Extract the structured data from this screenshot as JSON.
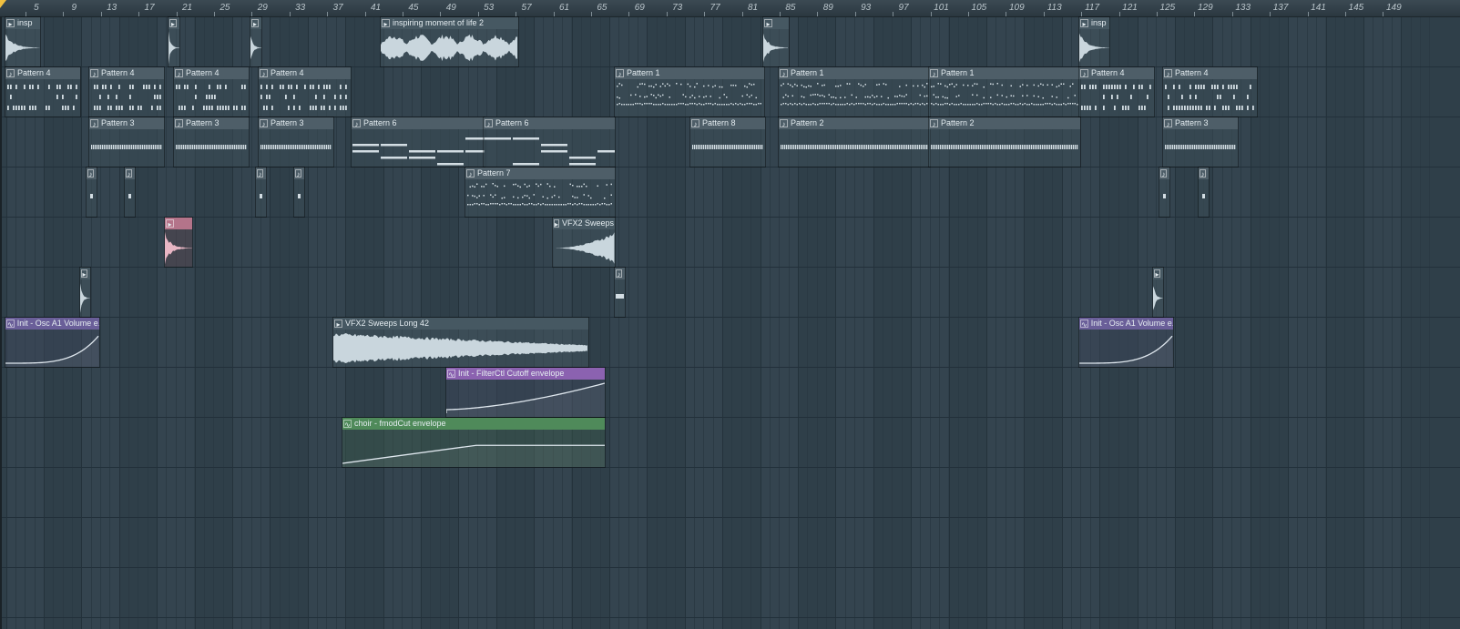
{
  "ruler": {
    "ticks": [
      "5",
      "9",
      "13",
      "17",
      "21",
      "25",
      "29",
      "33",
      "37",
      "41",
      "45",
      "49",
      "53",
      "57",
      "61",
      "65",
      "69",
      "73",
      "77",
      "81",
      "85",
      "89",
      "93",
      "97",
      "101",
      "105",
      "109",
      "113",
      "117",
      "121",
      "125",
      "129",
      "133",
      "137",
      "141",
      "145",
      "149"
    ]
  },
  "colors": {
    "background": "#2f3f49",
    "pattern_header": "#4e5e68",
    "audio_waveform": "#c9d6dd",
    "automation_purple": "#6a5f99",
    "automation_violet": "#8b62b0",
    "automation_green": "#4f8a5a",
    "audio_pink": "#b4748a"
  },
  "clips": [
    {
      "kind": "audio",
      "style": "audio",
      "label": "insp",
      "icon": "audio-clip-icon"
    },
    {
      "kind": "audio",
      "style": "audio",
      "label": "",
      "icon": "audio-clip-icon"
    },
    {
      "kind": "audio",
      "style": "audio",
      "label": "",
      "icon": "audio-clip-icon"
    },
    {
      "kind": "audio",
      "style": "audio",
      "label": "inspiring moment of life 2",
      "icon": "audio-clip-icon"
    },
    {
      "kind": "audio",
      "style": "audio",
      "label": "",
      "icon": "audio-clip-icon"
    },
    {
      "kind": "audio",
      "style": "audio",
      "label": "insp",
      "icon": "audio-clip-icon"
    },
    {
      "kind": "pattern",
      "style": "pattern",
      "label": "Pattern 4",
      "icon": "pattern-clip-icon",
      "notes": "drums"
    },
    {
      "kind": "pattern",
      "style": "pattern",
      "label": "Pattern 4",
      "icon": "pattern-clip-icon",
      "notes": "drums"
    },
    {
      "kind": "pattern",
      "style": "pattern",
      "label": "Pattern 4",
      "icon": "pattern-clip-icon",
      "notes": "drums"
    },
    {
      "kind": "pattern",
      "style": "pattern",
      "label": "Pattern 4",
      "icon": "pattern-clip-icon",
      "notes": "drums"
    },
    {
      "kind": "pattern",
      "style": "pattern",
      "label": "Pattern 1",
      "icon": "pattern-clip-icon",
      "notes": "arp"
    },
    {
      "kind": "pattern",
      "style": "pattern",
      "label": "Pattern 1",
      "icon": "pattern-clip-icon",
      "notes": "arp"
    },
    {
      "kind": "pattern",
      "style": "pattern",
      "label": "Pattern 1",
      "icon": "pattern-clip-icon",
      "notes": "arp"
    },
    {
      "kind": "pattern",
      "style": "pattern",
      "label": "Pattern 4",
      "icon": "pattern-clip-icon",
      "notes": "drums"
    },
    {
      "kind": "pattern",
      "style": "pattern",
      "label": "Pattern 4",
      "icon": "pattern-clip-icon",
      "notes": "drums"
    },
    {
      "kind": "pattern",
      "style": "pattern",
      "label": "Pattern 3",
      "icon": "pattern-clip-icon",
      "notes": "hats"
    },
    {
      "kind": "pattern",
      "style": "pattern",
      "label": "Pattern 3",
      "icon": "pattern-clip-icon",
      "notes": "hats"
    },
    {
      "kind": "pattern",
      "style": "pattern",
      "label": "Pattern 3",
      "icon": "pattern-clip-icon",
      "notes": "hats"
    },
    {
      "kind": "pattern",
      "style": "pattern",
      "label": "Pattern 6",
      "icon": "pattern-clip-icon",
      "notes": "chords"
    },
    {
      "kind": "pattern",
      "style": "pattern",
      "label": "Pattern 6",
      "icon": "pattern-clip-icon",
      "notes": "chords"
    },
    {
      "kind": "pattern",
      "style": "pattern",
      "label": "Pattern 8",
      "icon": "pattern-clip-icon",
      "notes": "hats"
    },
    {
      "kind": "pattern",
      "style": "pattern",
      "label": "Pattern 2",
      "icon": "pattern-clip-icon",
      "notes": "hats"
    },
    {
      "kind": "pattern",
      "style": "pattern",
      "label": "Pattern 2",
      "icon": "pattern-clip-icon",
      "notes": "hats"
    },
    {
      "kind": "pattern",
      "style": "pattern",
      "label": "Pattern 3",
      "icon": "pattern-clip-icon",
      "notes": "hats"
    },
    {
      "kind": "pattern",
      "style": "pattern",
      "label": "",
      "icon": "pattern-clip-icon",
      "notes": "single"
    },
    {
      "kind": "pattern",
      "style": "pattern",
      "label": "",
      "icon": "pattern-clip-icon",
      "notes": "single"
    },
    {
      "kind": "pattern",
      "style": "pattern",
      "label": "",
      "icon": "pattern-clip-icon",
      "notes": "single"
    },
    {
      "kind": "pattern",
      "style": "pattern",
      "label": "",
      "icon": "pattern-clip-icon",
      "notes": "single"
    },
    {
      "kind": "pattern",
      "style": "pattern",
      "label": "Pattern 7",
      "icon": "pattern-clip-icon",
      "notes": "arp"
    },
    {
      "kind": "pattern",
      "style": "pattern",
      "label": "",
      "icon": "pattern-clip-icon",
      "notes": "single"
    },
    {
      "kind": "pattern",
      "style": "pattern",
      "label": "",
      "icon": "pattern-clip-icon",
      "notes": "single"
    },
    {
      "kind": "audio",
      "style": "audio-pink",
      "label": "",
      "icon": "audio-clip-icon"
    },
    {
      "kind": "audio",
      "style": "audio",
      "label": "VFX2 Sweeps ...",
      "icon": "audio-clip-icon"
    },
    {
      "kind": "audio",
      "style": "audio",
      "label": "",
      "icon": "audio-clip-icon"
    },
    {
      "kind": "pattern",
      "style": "pattern",
      "label": "",
      "icon": "pattern-clip-icon",
      "notes": "block"
    },
    {
      "kind": "audio",
      "style": "audio",
      "label": "",
      "icon": "audio-clip-icon"
    },
    {
      "kind": "automation",
      "style": "auto-purple",
      "label": "Init - Osc A1 Volume e...",
      "icon": "automation-clip-icon",
      "curve": "expup"
    },
    {
      "kind": "audio",
      "style": "audio",
      "label": "VFX2 Sweeps Long 42",
      "icon": "audio-clip-icon"
    },
    {
      "kind": "automation",
      "style": "auto-purple",
      "label": "Init - Osc A1 Volume e...",
      "icon": "automation-clip-icon",
      "curve": "expup"
    },
    {
      "kind": "automation",
      "style": "auto-violet",
      "label": "Init - FilterCtl Cutoff envelope",
      "icon": "automation-clip-icon",
      "curve": "rise"
    },
    {
      "kind": "automation",
      "style": "auto-green",
      "label": "choir - fmodCut envelope",
      "icon": "automation-clip-icon",
      "curve": "ramp-hold"
    }
  ]
}
